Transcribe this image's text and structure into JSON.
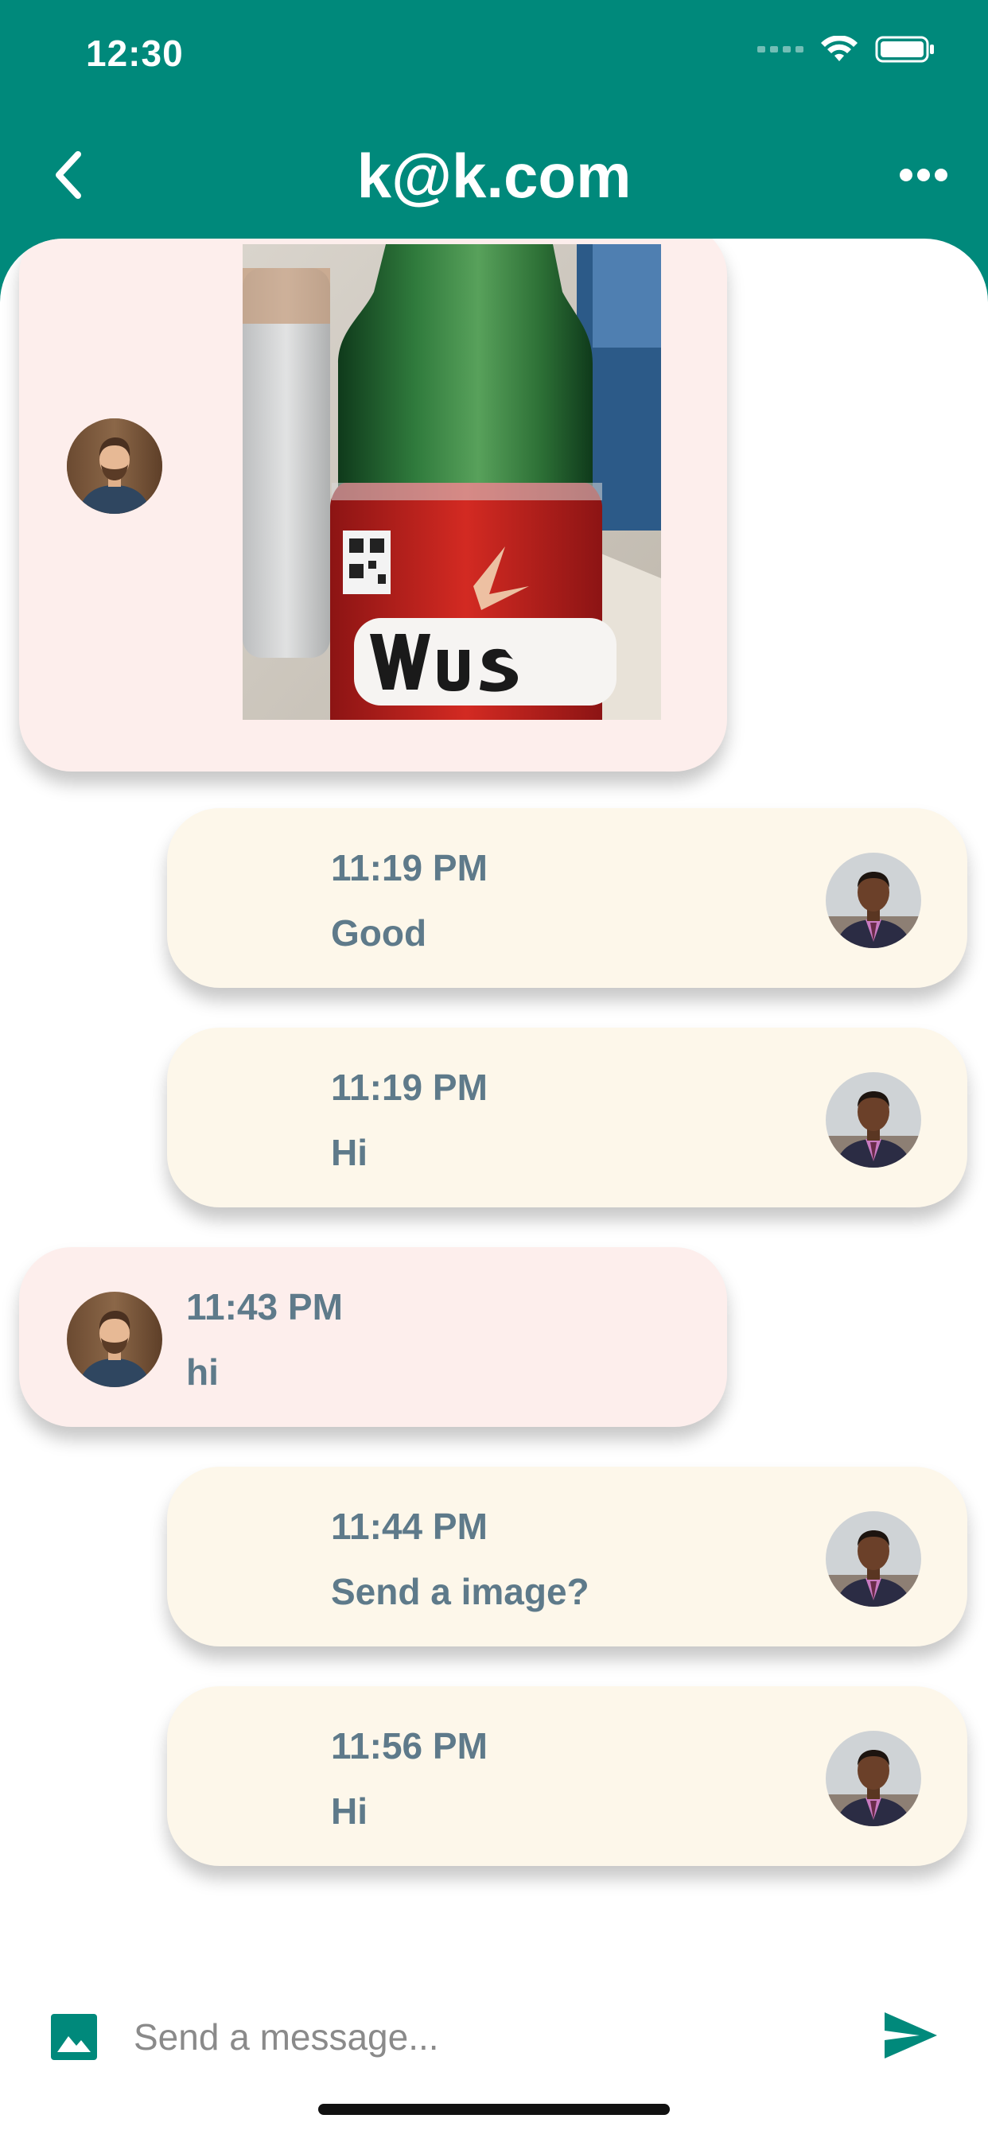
{
  "status_bar": {
    "time": "12:30",
    "wifi_icon": "wifi-icon",
    "battery_icon": "battery-icon"
  },
  "header": {
    "title": "k@k.com",
    "back_icon": "chevron-left-icon",
    "more_icon": "more-horizontal-icon"
  },
  "messages": [
    {
      "sender": "other",
      "type": "image",
      "avatar": "avatar-bearded-man",
      "image_description_icon": "photo-bottle"
    },
    {
      "sender": "me",
      "type": "text",
      "time": "11:19 PM",
      "text": "Good"
    },
    {
      "sender": "me",
      "type": "text",
      "time": "11:19 PM",
      "text": "Hi"
    },
    {
      "sender": "other",
      "type": "text",
      "time": "11:43 PM",
      "text": "hi"
    },
    {
      "sender": "me",
      "type": "text",
      "time": "11:44 PM",
      "text": "Send a image?"
    },
    {
      "sender": "me",
      "type": "text",
      "time": "11:56 PM",
      "text": "Hi"
    }
  ],
  "composer": {
    "placeholder": "Send a message...",
    "value": "",
    "image_icon": "image-icon",
    "send_icon": "send-icon"
  },
  "colors": {
    "primary": "#00897B",
    "their_bubble": "#FDEEEC",
    "my_bubble": "#FDF7EA",
    "message_text": "#5E7A8A"
  }
}
